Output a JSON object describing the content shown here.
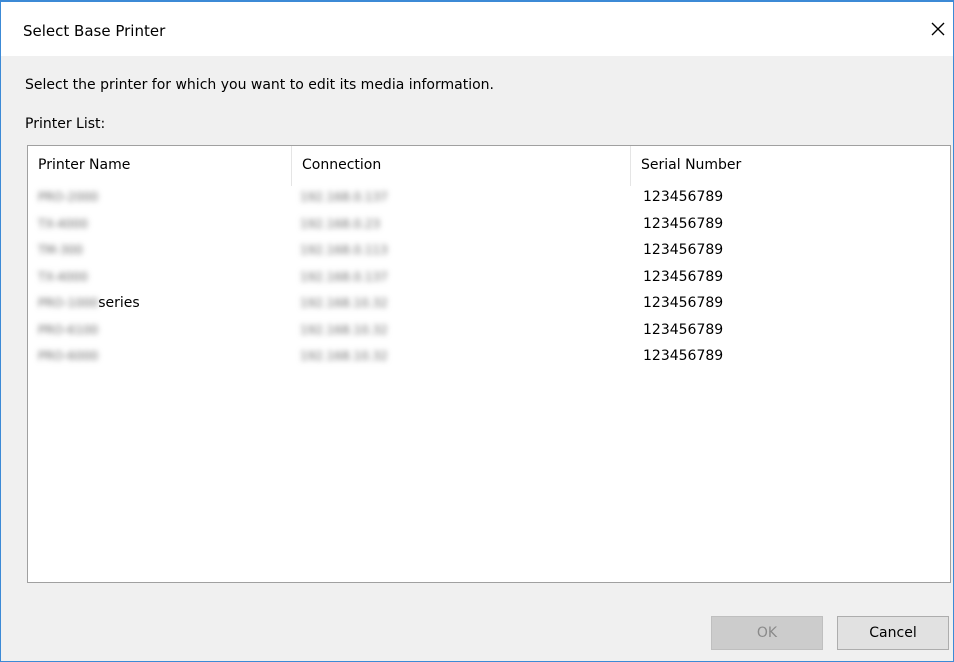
{
  "dialog": {
    "title": "Select Base Printer",
    "close_icon": "close-icon",
    "instruction": "Select the printer for which you want to edit its media information.",
    "list_label": "Printer List:"
  },
  "printer_list": {
    "columns": [
      "Printer Name",
      "Connection",
      "Serial Number"
    ],
    "rows": [
      {
        "name": "PRO-2000",
        "name_suffix": "",
        "connection": "192.168.0.137",
        "serial": "123456789"
      },
      {
        "name": "TX-4000",
        "name_suffix": "",
        "connection": "192.168.0.23",
        "serial": "123456789"
      },
      {
        "name": "TM-300",
        "name_suffix": "",
        "connection": "192.168.0.113",
        "serial": "123456789"
      },
      {
        "name": "TX-4000",
        "name_suffix": "",
        "connection": "192.168.0.137",
        "serial": "123456789"
      },
      {
        "name": "PRO-1000",
        "name_suffix": "series",
        "connection": "192.168.10.32",
        "serial": "123456789"
      },
      {
        "name": "PRO-6100",
        "name_suffix": "",
        "connection": "192.168.10.32",
        "serial": "123456789"
      },
      {
        "name": "PRO-6000",
        "name_suffix": "",
        "connection": "192.168.10.32",
        "serial": "123456789"
      }
    ]
  },
  "buttons": {
    "ok": "OK",
    "cancel": "Cancel"
  }
}
